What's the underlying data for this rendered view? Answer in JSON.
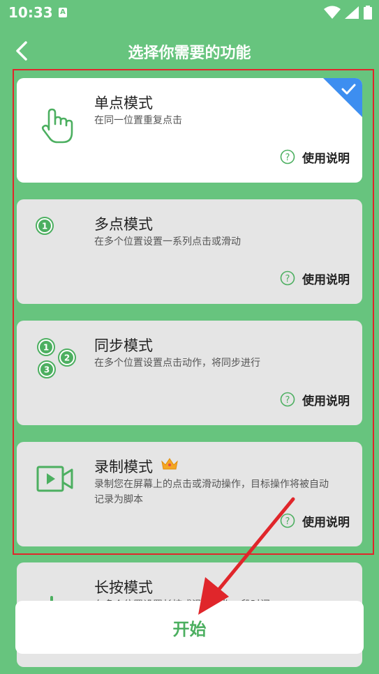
{
  "status_bar": {
    "time": "10:33",
    "notification_letter": "A"
  },
  "header": {
    "title": "选择你需要的功能"
  },
  "modes": [
    {
      "title": "单点模式",
      "description": "在同一位置重复点击",
      "help_label": "使用说明",
      "selected": true
    },
    {
      "title": "多点模式",
      "description": "在多个位置设置一系列点击或滑动",
      "help_label": "使用说明",
      "selected": false,
      "marker_numbers": [
        "1"
      ]
    },
    {
      "title": "同步模式",
      "description": "在多个位置设置点击动作，将同步进行",
      "help_label": "使用说明",
      "selected": false,
      "marker_numbers": [
        "1",
        "2",
        "3"
      ]
    },
    {
      "title": "录制模式",
      "description": "录制您在屏幕上的点击或滑动操作，目标操作将被自动记录为脚本",
      "help_label": "使用说明",
      "selected": false,
      "badge": "crown-icon"
    },
    {
      "title": "长按模式",
      "description": "在多个位置设置长按或滑动操作，段时间",
      "selected": false
    }
  ],
  "start_button": {
    "label": "开始"
  },
  "colors": {
    "background": "#67c47e",
    "accent_green": "#4caf60",
    "selected_check": "#3d8ef0",
    "highlight_red": "#e0262b",
    "card_default": "#e5e5e5",
    "card_selected": "#ffffff"
  }
}
